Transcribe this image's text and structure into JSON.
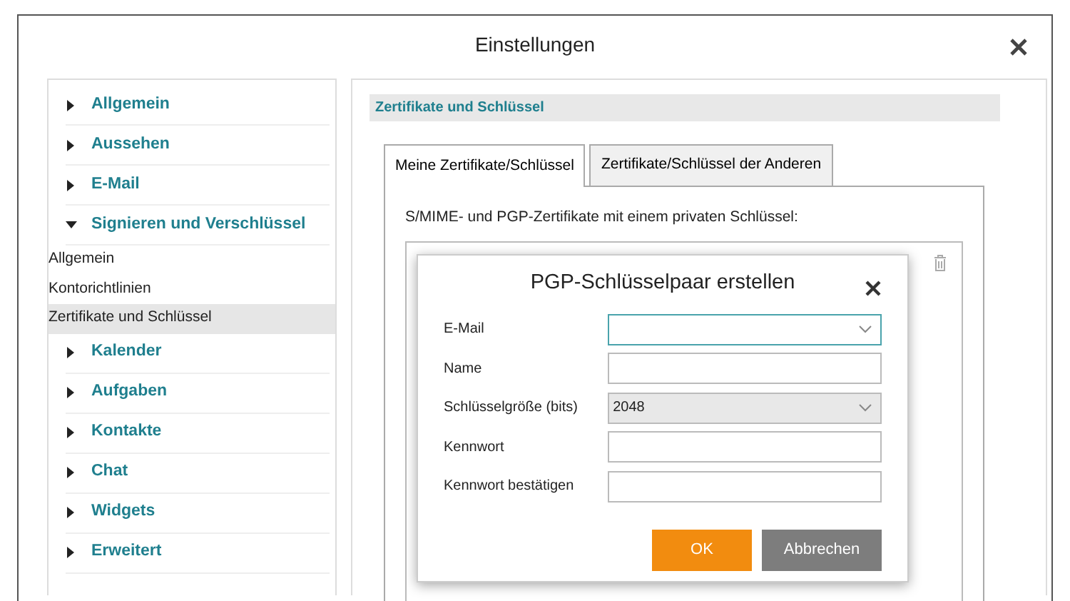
{
  "window": {
    "title": "Einstellungen"
  },
  "sidebar": {
    "items": [
      {
        "label": "Allgemein",
        "expanded": false
      },
      {
        "label": "Aussehen",
        "expanded": false
      },
      {
        "label": "E-Mail",
        "expanded": false
      },
      {
        "label": "Signieren und Verschlüssel",
        "expanded": true,
        "children": [
          {
            "label": "Allgemein",
            "selected": false
          },
          {
            "label": "Kontorichtlinien",
            "selected": false
          },
          {
            "label": "Zertifikate und Schlüssel",
            "selected": true
          }
        ]
      },
      {
        "label": "Kalender",
        "expanded": false
      },
      {
        "label": "Aufgaben",
        "expanded": false
      },
      {
        "label": "Kontakte",
        "expanded": false
      },
      {
        "label": "Chat",
        "expanded": false
      },
      {
        "label": "Widgets",
        "expanded": false
      },
      {
        "label": "Erweitert",
        "expanded": false
      }
    ]
  },
  "section": {
    "title": "Zertifikate und Schlüssel"
  },
  "tabs": [
    {
      "label": "Meine Zertifikate/Schlüssel",
      "selected": true
    },
    {
      "label": "Zertifikate/Schlüssel der Anderen",
      "selected": false
    }
  ],
  "certificates": {
    "caption": "S/MIME- und PGP-Zertifikate mit einem privaten Schlüssel:"
  },
  "dialog": {
    "title": "PGP-Schlüsselpaar erstellen",
    "fields": [
      {
        "label": "E-Mail",
        "kind": "dropdown",
        "focused": true
      },
      {
        "label": "Name",
        "kind": "text",
        "focused": false
      },
      {
        "label": "Schlüsselgröße (bits)",
        "kind": "select",
        "value": "2048",
        "focused": false
      },
      {
        "label": "Kennwort",
        "kind": "text",
        "focused": false
      },
      {
        "label": "Kennwort bestätigen",
        "kind": "text",
        "focused": false
      }
    ],
    "buttons": [
      {
        "label": "OK",
        "kind": "primary"
      },
      {
        "label": "Abbrechen",
        "kind": "secondary"
      }
    ]
  }
}
